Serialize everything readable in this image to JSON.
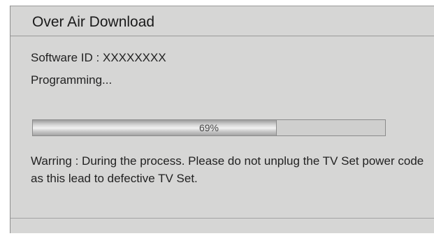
{
  "dialog": {
    "title": "Over Air Download",
    "software_id": "Software ID : XXXXXXXX",
    "status": "Programming...",
    "progress": {
      "value": 0.69,
      "label": "69%"
    },
    "warning": "Warring : During the process. Please do not unplug the TV Set power code as this lead to defective TV Set."
  }
}
